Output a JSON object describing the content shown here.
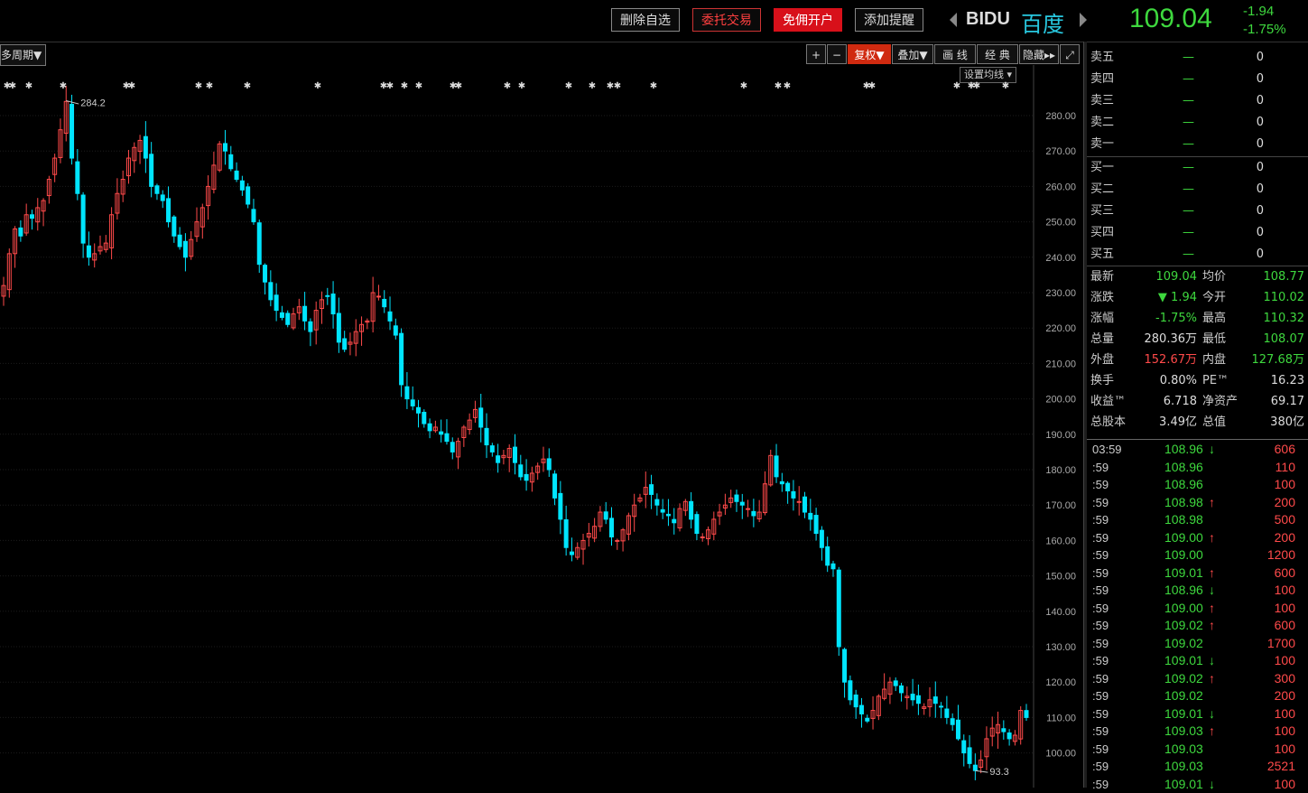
{
  "header": {
    "buttons": [
      {
        "label": "删除自选",
        "style": "outline"
      },
      {
        "label": "委托交易",
        "style": "red-outline"
      },
      {
        "label": "免佣开户",
        "style": "red-fill"
      },
      {
        "label": "添加提醒",
        "style": "outline"
      }
    ],
    "symbol": "BIDU",
    "name": "百度",
    "price": "109.04",
    "change": "-1.94",
    "change_pct": "-1.75%"
  },
  "toolbar": {
    "period_label": "多周期",
    "tools": [
      {
        "label": "+",
        "active": false
      },
      {
        "label": "−",
        "active": false
      },
      {
        "label": "复权",
        "active": true
      },
      {
        "label": "叠加",
        "active": false
      },
      {
        "label": "画 线",
        "active": false
      },
      {
        "label": "经 典",
        "active": false
      },
      {
        "label": "隐藏",
        "active": false
      },
      {
        "label": "⤢",
        "active": false
      }
    ],
    "set_ma": "设置均线"
  },
  "chart_data": {
    "type": "candlestick",
    "y_ticks": [
      "280.00",
      "270.00",
      "260.00",
      "250.00",
      "240.00",
      "230.00",
      "220.00",
      "210.00",
      "200.00",
      "190.00",
      "180.00",
      "170.00",
      "160.00",
      "150.00",
      "140.00",
      "130.00",
      "120.00",
      "110.00",
      "100.00"
    ],
    "ylim": [
      95,
      285
    ],
    "max_label": "284.2",
    "min_label": "93.3",
    "grid": true,
    "up_color": "#ff4a4a",
    "down_color": "#00e5ff",
    "closes": [
      232,
      241,
      248,
      246,
      252,
      251,
      254,
      256,
      262,
      268,
      276,
      284,
      268,
      258,
      244,
      240,
      241,
      243,
      244,
      252,
      258,
      262,
      268,
      271,
      273,
      268,
      260,
      258,
      256,
      250,
      246,
      243,
      240,
      245,
      250,
      254,
      260,
      266,
      272,
      270,
      265,
      262,
      259,
      255,
      250,
      238,
      233,
      228,
      225,
      223,
      221,
      224,
      226,
      222,
      219,
      225,
      228,
      229,
      224,
      216,
      214,
      216,
      219,
      221,
      222,
      230,
      229,
      226,
      222,
      218,
      204,
      200,
      198,
      196,
      193,
      191,
      192,
      190,
      188,
      185,
      188,
      192,
      194,
      197,
      192,
      187,
      185,
      182,
      184,
      186,
      182,
      178,
      177,
      179,
      181,
      183,
      180,
      172,
      166,
      158,
      156,
      158,
      160,
      162,
      164,
      168,
      166,
      161,
      160,
      163,
      167,
      170,
      172,
      175,
      173,
      170,
      168,
      167,
      165,
      169,
      171,
      166,
      162,
      161,
      163,
      166,
      168,
      170,
      172,
      171,
      170,
      169,
      167,
      168,
      176,
      184,
      178,
      176,
      174,
      172,
      171,
      168,
      166,
      162,
      158,
      153,
      152,
      130,
      120,
      115,
      113,
      111,
      109,
      112,
      116,
      118,
      120,
      119,
      117,
      116,
      115,
      114,
      113,
      115,
      114,
      113,
      110,
      108,
      104,
      100,
      97,
      95,
      98,
      104,
      107,
      108,
      106,
      104,
      105,
      112,
      110
    ],
    "markers": "★ symbols along top of chart"
  },
  "orderbook": {
    "asks": [
      {
        "label": "卖五",
        "price": "—",
        "vol": "0"
      },
      {
        "label": "卖四",
        "price": "—",
        "vol": "0"
      },
      {
        "label": "卖三",
        "price": "—",
        "vol": "0"
      },
      {
        "label": "卖二",
        "price": "—",
        "vol": "0"
      },
      {
        "label": "卖一",
        "price": "—",
        "vol": "0"
      }
    ],
    "bids": [
      {
        "label": "买一",
        "price": "—",
        "vol": "0"
      },
      {
        "label": "买二",
        "price": "—",
        "vol": "0"
      },
      {
        "label": "买三",
        "price": "—",
        "vol": "0"
      },
      {
        "label": "买四",
        "price": "—",
        "vol": "0"
      },
      {
        "label": "买五",
        "price": "—",
        "vol": "0"
      }
    ]
  },
  "stats": [
    {
      "l1": "最新",
      "v1": "109.04",
      "c1": "g",
      "l2": "均价",
      "v2": "108.77",
      "c2": "g"
    },
    {
      "l1": "涨跌",
      "v1": "▼ 1.94",
      "c1": "g",
      "l2": "今开",
      "v2": "110.02",
      "c2": "g"
    },
    {
      "l1": "涨幅",
      "v1": "-1.75%",
      "c1": "g",
      "l2": "最高",
      "v2": "110.32",
      "c2": "g"
    },
    {
      "l1": "总量",
      "v1": "280.36万",
      "c1": "w",
      "l2": "最低",
      "v2": "108.07",
      "c2": "g"
    },
    {
      "l1": "外盘",
      "v1": "152.67万",
      "c1": "r",
      "l2": "内盘",
      "v2": "127.68万",
      "c2": "g"
    },
    {
      "l1": "换手",
      "v1": "0.80%",
      "c1": "w",
      "l2": "PE™",
      "v2": "16.23",
      "c2": "w"
    },
    {
      "l1": "收益™",
      "v1": "6.718",
      "c1": "w",
      "l2": "净资产",
      "v2": "69.17",
      "c2": "w"
    },
    {
      "l1": "总股本",
      "v1": "3.49亿",
      "c1": "w",
      "l2": "总值",
      "v2": "380亿",
      "c2": "w"
    }
  ],
  "ticks": [
    {
      "time": "03:59",
      "price": "108.96",
      "dir": "dn",
      "vol": "606"
    },
    {
      "time": ":59",
      "price": "108.96",
      "dir": "",
      "vol": "110"
    },
    {
      "time": ":59",
      "price": "108.96",
      "dir": "",
      "vol": "100"
    },
    {
      "time": ":59",
      "price": "108.98",
      "dir": "up",
      "vol": "200"
    },
    {
      "time": ":59",
      "price": "108.98",
      "dir": "",
      "vol": "500"
    },
    {
      "time": ":59",
      "price": "109.00",
      "dir": "up",
      "vol": "200"
    },
    {
      "time": ":59",
      "price": "109.00",
      "dir": "",
      "vol": "1200"
    },
    {
      "time": ":59",
      "price": "109.01",
      "dir": "up",
      "vol": "600"
    },
    {
      "time": ":59",
      "price": "108.96",
      "dir": "dn",
      "vol": "100"
    },
    {
      "time": ":59",
      "price": "109.00",
      "dir": "up",
      "vol": "100"
    },
    {
      "time": ":59",
      "price": "109.02",
      "dir": "up",
      "vol": "600"
    },
    {
      "time": ":59",
      "price": "109.02",
      "dir": "",
      "vol": "1700"
    },
    {
      "time": ":59",
      "price": "109.01",
      "dir": "dn",
      "vol": "100"
    },
    {
      "time": ":59",
      "price": "109.02",
      "dir": "up",
      "vol": "300"
    },
    {
      "time": ":59",
      "price": "109.02",
      "dir": "",
      "vol": "200"
    },
    {
      "time": ":59",
      "price": "109.01",
      "dir": "dn",
      "vol": "100"
    },
    {
      "time": ":59",
      "price": "109.03",
      "dir": "up",
      "vol": "100"
    },
    {
      "time": ":59",
      "price": "109.03",
      "dir": "",
      "vol": "100"
    },
    {
      "time": ":59",
      "price": "109.03",
      "dir": "",
      "vol": "2521"
    },
    {
      "time": ":59",
      "price": "109.01",
      "dir": "dn",
      "vol": "100"
    }
  ]
}
